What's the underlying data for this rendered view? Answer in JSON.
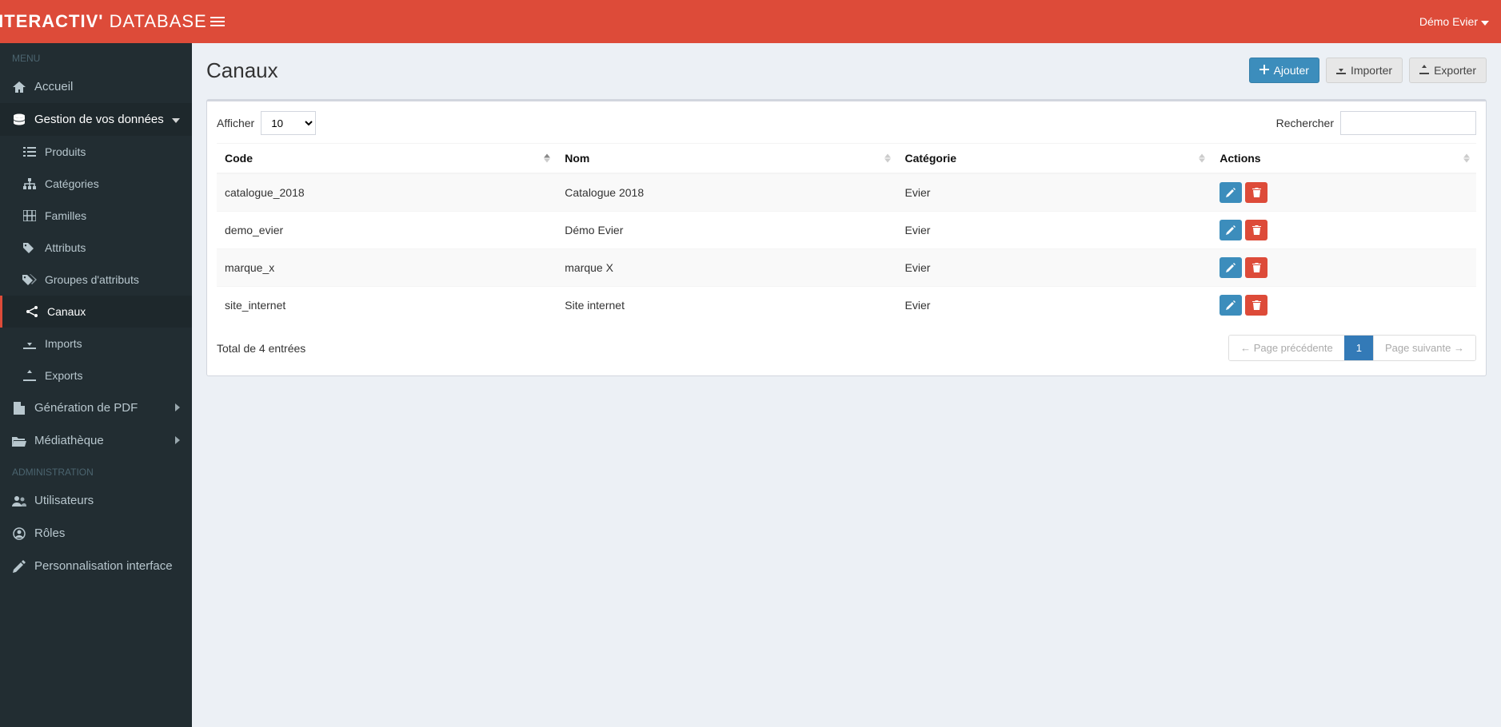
{
  "brand": {
    "part1": "INTERACTIV'",
    "part2": "DATABASE"
  },
  "user": {
    "name": "Démo Evier"
  },
  "sidebar": {
    "menu_title": "MENU",
    "admin_title": "ADMINISTRATION",
    "items": {
      "accueil": "Accueil",
      "gestion": "Gestion de vos données",
      "produits": "Produits",
      "categories": "Catégories",
      "familles": "Familles",
      "attributs": "Attributs",
      "groupes": "Groupes d'attributs",
      "canaux": "Canaux",
      "imports": "Imports",
      "exports": "Exports",
      "pdf": "Génération de PDF",
      "media": "Médiathèque",
      "utilisateurs": "Utilisateurs",
      "roles": "Rôles",
      "perso": "Personnalisation interface"
    }
  },
  "page": {
    "title": "Canaux",
    "add_btn": "Ajouter",
    "import_btn": "Importer",
    "export_btn": "Exporter"
  },
  "table": {
    "show_label": "Afficher",
    "show_value": "10",
    "search_label": "Rechercher",
    "columns": {
      "code": "Code",
      "nom": "Nom",
      "categorie": "Catégorie",
      "actions": "Actions"
    },
    "rows": [
      {
        "code": "catalogue_2018",
        "nom": "Catalogue 2018",
        "categorie": "Evier"
      },
      {
        "code": "demo_evier",
        "nom": "Démo Evier",
        "categorie": "Evier"
      },
      {
        "code": "marque_x",
        "nom": "marque X",
        "categorie": "Evier"
      },
      {
        "code": "site_internet",
        "nom": "Site internet",
        "categorie": "Evier"
      }
    ],
    "footer_info": "Total de 4 entrées",
    "page_prev": "Page précédente",
    "page_next": "Page suivante",
    "page_current": "1"
  }
}
